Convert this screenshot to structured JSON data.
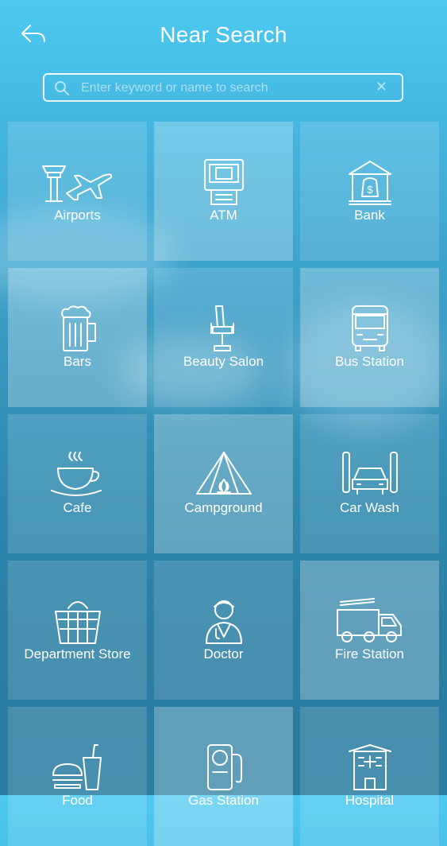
{
  "header": {
    "title": "Near Search"
  },
  "search": {
    "placeholder": "Enter keyword or name to search",
    "value": ""
  },
  "categories": [
    {
      "label": "Airports",
      "icon": "airport-icon"
    },
    {
      "label": "ATM",
      "icon": "atm-icon"
    },
    {
      "label": "Bank",
      "icon": "bank-icon"
    },
    {
      "label": "Bars",
      "icon": "beer-mug-icon"
    },
    {
      "label": "Beauty Salon",
      "icon": "salon-chair-icon"
    },
    {
      "label": "Bus Station",
      "icon": "bus-icon"
    },
    {
      "label": "Cafe",
      "icon": "coffee-cup-icon"
    },
    {
      "label": "Campground",
      "icon": "tent-icon"
    },
    {
      "label": "Car Wash",
      "icon": "car-wash-icon"
    },
    {
      "label": "Department Store",
      "icon": "shopping-basket-icon"
    },
    {
      "label": "Doctor",
      "icon": "doctor-icon"
    },
    {
      "label": "Fire Station",
      "icon": "fire-truck-icon"
    },
    {
      "label": "Food",
      "icon": "fast-food-icon"
    },
    {
      "label": "Gas Station",
      "icon": "gas-pump-icon"
    },
    {
      "label": "Hospital",
      "icon": "hospital-icon"
    }
  ]
}
